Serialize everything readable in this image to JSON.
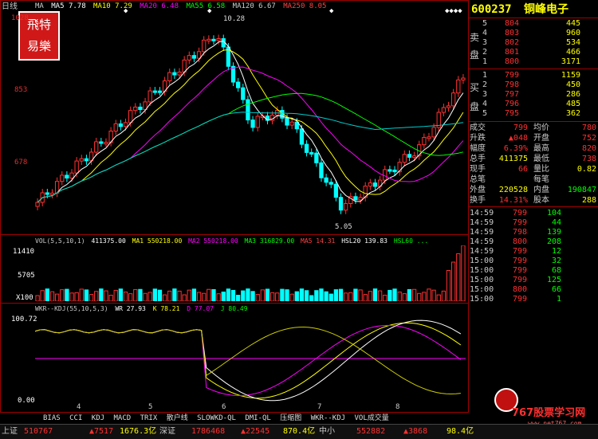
{
  "chart": {
    "period_label": "日线",
    "ma_legend": [
      {
        "text": "MA",
        "color": "#cccccc"
      },
      {
        "text": "MA5 7.78",
        "color": "#ffffff"
      },
      {
        "text": "MA10 7.29",
        "color": "#ffff00"
      },
      {
        "text": "MA20 6.48",
        "color": "#ff00ff"
      },
      {
        "text": "MA55 6.58",
        "color": "#00ff00"
      },
      {
        "text": "MA120 6.67",
        "color": "#cccccc"
      },
      {
        "text": "MA250 8.05",
        "color": "#ff4040"
      }
    ],
    "price_axis": [
      "1028",
      "853",
      "678"
    ],
    "high_label": "10.28",
    "low_label": "5.05",
    "vol_legend": [
      {
        "text": "VOL(5,5,10,1)",
        "color": "#cccccc"
      },
      {
        "text": "411375.00",
        "color": "#ffffff"
      },
      {
        "text": "MA1 550218.00",
        "color": "#ffff00"
      },
      {
        "text": "MA2 550218.00",
        "color": "#ff00ff"
      },
      {
        "text": "MA3 316829.00",
        "color": "#00ff00"
      },
      {
        "text": "MA5 14.31",
        "color": "#ff4040"
      },
      {
        "text": "HSL20 139.83",
        "color": "#ffffff"
      },
      {
        "text": "HSL60 ...",
        "color": "#00ff00"
      }
    ],
    "vol_axis": [
      "11410",
      "5705",
      "X100"
    ],
    "kdj_legend": [
      {
        "text": "WKR--KDJ(55,10,5,3)",
        "color": "#cccccc"
      },
      {
        "text": "WR 27.93",
        "color": "#ffffff"
      },
      {
        "text": "K 78.21",
        "color": "#ffff00"
      },
      {
        "text": "D 77.07",
        "color": "#ff00ff"
      },
      {
        "text": "J 80.49",
        "color": "#00ff00"
      }
    ],
    "kdj_axis": [
      "100.72",
      "0.00"
    ],
    "date_axis": [
      "4",
      "5",
      "6",
      "7",
      "8"
    ],
    "stamp_text": "飛特 易樂",
    "tabs": [
      "BIAS",
      "CCI",
      "KDJ",
      "MACD",
      "TRIX",
      "散户线",
      "SLOWKD-QL",
      "DMI-QL",
      "压缩图",
      "WKR--KDJ",
      "VOL成交量"
    ],
    "watermark_text": "767股票学习网",
    "watermark_url": "www.net767.com"
  },
  "quote": {
    "code": "600237",
    "name": "铜峰电子",
    "sell_label_a": "卖",
    "sell_label_b": "盘",
    "buy_label_a": "买",
    "buy_label_b": "盘",
    "sell": [
      {
        "lvl": "5",
        "price": "804",
        "vol": "445"
      },
      {
        "lvl": "4",
        "price": "803",
        "vol": "960"
      },
      {
        "lvl": "3",
        "price": "802",
        "vol": "534"
      },
      {
        "lvl": "2",
        "price": "801",
        "vol": "466"
      },
      {
        "lvl": "1",
        "price": "800",
        "vol": "3171"
      }
    ],
    "buy": [
      {
        "lvl": "1",
        "price": "799",
        "vol": "1159"
      },
      {
        "lvl": "2",
        "price": "798",
        "vol": "450"
      },
      {
        "lvl": "3",
        "price": "797",
        "vol": "286"
      },
      {
        "lvl": "4",
        "price": "796",
        "vol": "485"
      },
      {
        "lvl": "5",
        "price": "795",
        "vol": "362"
      }
    ],
    "stats": [
      {
        "k1": "成交",
        "v1": "799",
        "k2": "均价",
        "v2": "780"
      },
      {
        "k1": "升跌",
        "v1": "▲048",
        "k2": "开盘",
        "v2": "752"
      },
      {
        "k1": "幅度",
        "v1": "6.39%",
        "k2": "最高",
        "v2": "820"
      },
      {
        "k1": "总手",
        "v1": "411375",
        "k2": "最低",
        "v2": "738"
      },
      {
        "k1": "现手",
        "v1": "66",
        "k2": "量比",
        "v2": "0.82"
      },
      {
        "k1": "总笔",
        "v1": "",
        "k2": "每笔",
        "v2": ""
      },
      {
        "k1": "外盘",
        "v1": "220528",
        "k2": "内盘",
        "v2": "190847"
      },
      {
        "k1": "换手",
        "v1": "14.31%",
        "k2": "股本",
        "v2": "288"
      }
    ],
    "ticks": [
      {
        "t": "14:59",
        "p": "799",
        "v": "104"
      },
      {
        "t": "14:59",
        "p": "799",
        "v": "44"
      },
      {
        "t": "14:59",
        "p": "798",
        "v": "139"
      },
      {
        "t": "14:59",
        "p": "800",
        "v": "208"
      },
      {
        "t": "14:59",
        "p": "799",
        "v": "12"
      },
      {
        "t": "15:00",
        "p": "799",
        "v": "32"
      },
      {
        "t": "15:00",
        "p": "799",
        "v": "68"
      },
      {
        "t": "15:00",
        "p": "799",
        "v": "125"
      },
      {
        "t": "15:00",
        "p": "800",
        "v": "66"
      },
      {
        "t": "15:00",
        "p": "799",
        "v": "1"
      }
    ]
  },
  "status": {
    "sh_label": "上证",
    "sh_index": "510767",
    "sh_change": "▲7517",
    "sh_amount": "1676.3亿",
    "sz_label": "深证",
    "sz_index": "1786468",
    "sz_change": "▲22545",
    "sz_amount": "870.4亿",
    "zx_label": "中小",
    "zx_index": "552882",
    "zx_change": "▲3868",
    "zx_amount": "98.4亿"
  },
  "colors": {
    "up": "#ff3030",
    "down": "#00ffff",
    "frame": "#a00000",
    "accent": "#ffff00"
  }
}
